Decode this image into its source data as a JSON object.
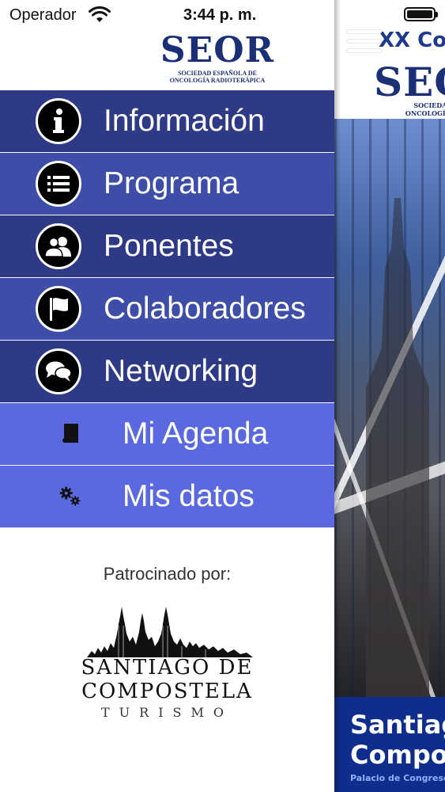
{
  "status_bar": {
    "carrier": "Operador",
    "time": "3:44 p. m."
  },
  "brand": {
    "logo": "SEOR",
    "subtitle_line1": "SOCIEDAD ESPAÑOLA DE",
    "subtitle_line2": "ONCOLOGÍA RADIOTERÁPICA"
  },
  "menu": {
    "items": [
      {
        "label": "Información",
        "icon": "info-icon"
      },
      {
        "label": "Programa",
        "icon": "list-icon"
      },
      {
        "label": "Ponentes",
        "icon": "users-icon"
      },
      {
        "label": "Colaboradores",
        "icon": "flag-icon"
      },
      {
        "label": "Networking",
        "icon": "chat-icon"
      },
      {
        "label": "Mi Agenda",
        "icon": "book-icon"
      },
      {
        "label": "Mis datos",
        "icon": "gears-icon"
      }
    ]
  },
  "sponsor": {
    "title": "Patrocinado por:",
    "line1": "SANTIAGO DE",
    "line2": "COMPOSTELA",
    "line3": "TURISMO"
  },
  "background_screen": {
    "title": "XX Con",
    "logo": "SEOR",
    "logo_sub1": "SOCIEDAD ESPA",
    "logo_sub2": "ONCOLOGÍA RADIOT",
    "city_line1": "Santiag",
    "city_line2": "Compos",
    "venue": "Palacio de Congresos y"
  },
  "colors": {
    "menu_dark": "#2f3a87",
    "menu_mid": "#3e4da7",
    "menu_light": "#5b69e0",
    "brand_blue": "#1a2f76",
    "city_band": "#0f2d8c"
  }
}
